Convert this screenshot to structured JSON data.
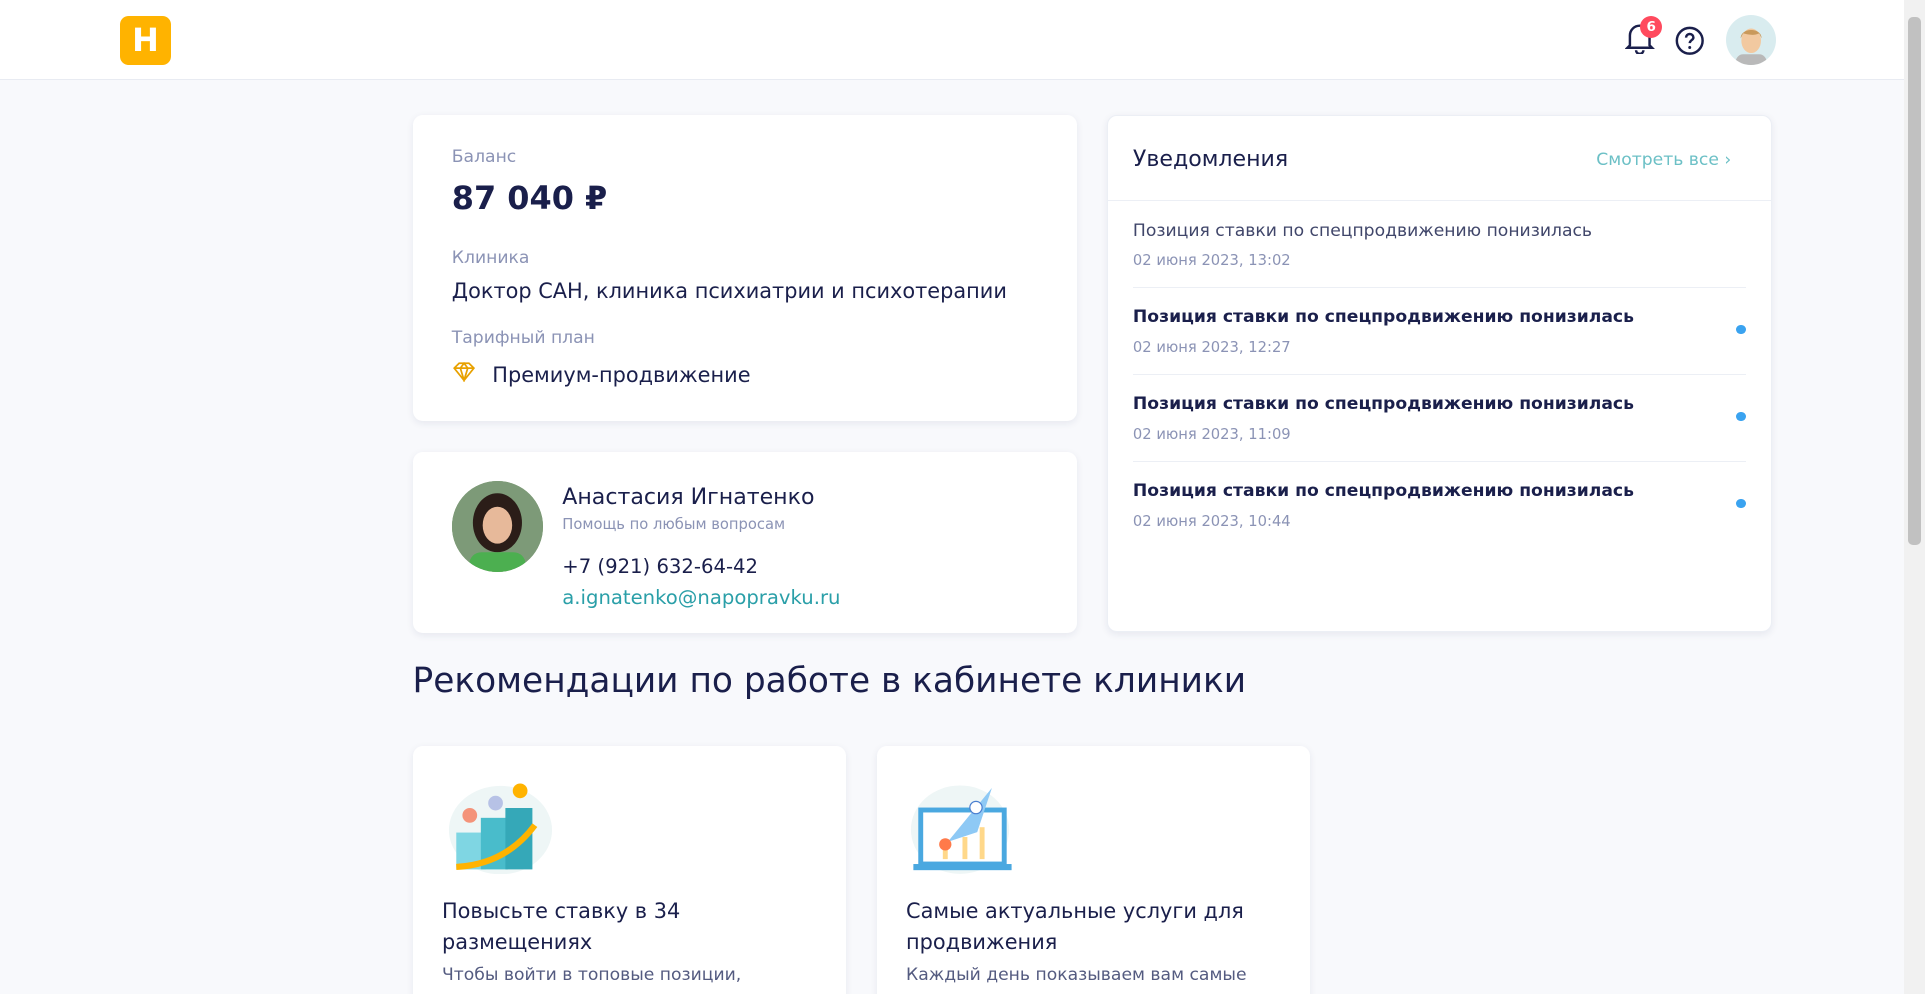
{
  "header": {
    "logo": "Н",
    "notification_count": "6"
  },
  "balance": {
    "label": "Баланс",
    "value": "87 040 ₽",
    "clinic_label": "Клиника",
    "clinic": "Доктор САН, клиника психиатрии и психотерапии",
    "plan_label": "Тарифный план",
    "plan": "Премиум-продвижение"
  },
  "manager": {
    "name": "Анастасия Игнатенко",
    "role": "Помощь по любым вопросам",
    "phone": "+7 (921) 632-64-42",
    "email": "a.ignatenko@napopravku.ru"
  },
  "notifications": {
    "title": "Уведомления",
    "view_all": "Смотреть все",
    "items": [
      {
        "text": "Позиция ставки по спецпродвижению понизилась",
        "date": "02 июня 2023, 13:02",
        "unread": false
      },
      {
        "text": "Позиция ставки по спецпродвижению понизилась",
        "date": "02 июня 2023, 12:27",
        "unread": true
      },
      {
        "text": "Позиция ставки по спецпродвижению понизилась",
        "date": "02 июня 2023, 11:09",
        "unread": true
      },
      {
        "text": "Позиция ставки по спецпродвижению понизилась",
        "date": "02 июня 2023, 10:44",
        "unread": true
      }
    ]
  },
  "recommendations": {
    "title": "Рекомендации по работе в кабинете клиники",
    "cards": [
      {
        "title": "Повысьте ставку в 34 размещениях",
        "desc": "Чтобы войти в топовые позиции,"
      },
      {
        "title": "Самые актуальные услуги для продвижения",
        "desc": "Каждый день показываем вам самые"
      }
    ]
  },
  "colors": {
    "accent": "#ffb300",
    "link": "#2a9fa8",
    "badge": "#ff4a5e",
    "unread_dot": "#3aa3f0"
  }
}
